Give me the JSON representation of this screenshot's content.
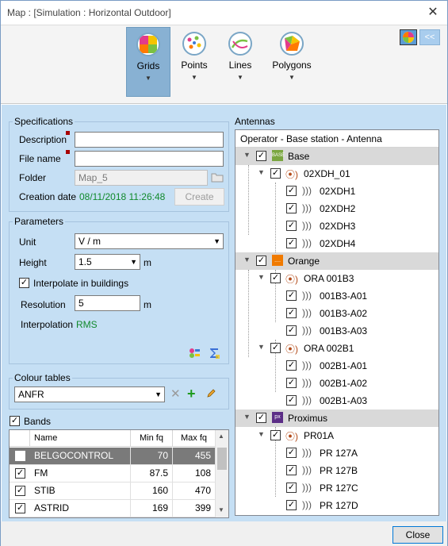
{
  "window": {
    "title": "Map : [Simulation : Horizontal Outdoor]"
  },
  "ribbon": {
    "buttons": [
      {
        "label": "Grids",
        "icon": "grid-globe-icon",
        "active": true
      },
      {
        "label": "Points",
        "icon": "points-globe-icon",
        "active": false
      },
      {
        "label": "Lines",
        "icon": "lines-globe-icon",
        "active": false
      },
      {
        "label": "Polygons",
        "icon": "polygons-globe-icon",
        "active": false
      }
    ],
    "right_buttons": [
      "palette-icon",
      "collapse-icon"
    ],
    "collapse_label": "<<"
  },
  "specifications": {
    "legend": "Specifications",
    "description_label": "Description",
    "description_value": "",
    "filename_label": "File name",
    "filename_value": "",
    "folder_label": "Folder",
    "folder_value": "Map_5",
    "creation_label": "Creation date",
    "creation_value": "08/11/2018 11:26:48",
    "create_button": "Create"
  },
  "parameters": {
    "legend": "Parameters",
    "unit_label": "Unit",
    "unit_value": "V / m",
    "height_label": "Height",
    "height_value": "1.5",
    "height_unit": "m",
    "interpolate_label": "Interpolate in buildings",
    "interpolate_checked": true,
    "resolution_label": "Resolution",
    "resolution_value": "5",
    "resolution_unit": "m",
    "interpolation_label": "Interpolation",
    "interpolation_value": "RMS"
  },
  "colour_tables": {
    "legend": "Colour tables",
    "selected": "ANFR"
  },
  "bands": {
    "label": "Bands",
    "checked": true,
    "columns": [
      "Name",
      "Min fq",
      "Max fq"
    ],
    "rows": [
      {
        "name": "BELGOCONTROL",
        "min": "70",
        "max": "455",
        "checked": true,
        "selected": true
      },
      {
        "name": "FM",
        "min": "87.5",
        "max": "108",
        "checked": true,
        "selected": false
      },
      {
        "name": "STIB",
        "min": "160",
        "max": "470",
        "checked": true,
        "selected": false
      },
      {
        "name": "ASTRID",
        "min": "169",
        "max": "399",
        "checked": true,
        "selected": false
      }
    ]
  },
  "antennas": {
    "label": "Antennas",
    "header": "Operator - Base station - Antenna",
    "operators": [
      {
        "name": "Base",
        "logo_text": "BASE",
        "logo_color": "#7aa640",
        "stations": [
          {
            "name": "02XDH_01",
            "antennas": [
              "02XDH1",
              "02XDH2",
              "02XDH3",
              "02XDH4"
            ]
          }
        ]
      },
      {
        "name": "Orange",
        "logo_text": "....",
        "logo_color": "#f07a00",
        "stations": [
          {
            "name": "ORA 001B3",
            "antennas": [
              "001B3-A01",
              "001B3-A02",
              "001B3-A03"
            ]
          },
          {
            "name": "ORA 002B1",
            "antennas": [
              "002B1-A01",
              "002B1-A02",
              "002B1-A03"
            ]
          }
        ]
      },
      {
        "name": "Proximus",
        "logo_text": "px",
        "logo_color": "#5b2d86",
        "stations": [
          {
            "name": "PR01A",
            "antennas": [
              "PR 127A",
              "PR 127B",
              "PR 127C",
              "PR 127D"
            ]
          }
        ]
      }
    ]
  },
  "footer": {
    "close_button": "Close"
  }
}
